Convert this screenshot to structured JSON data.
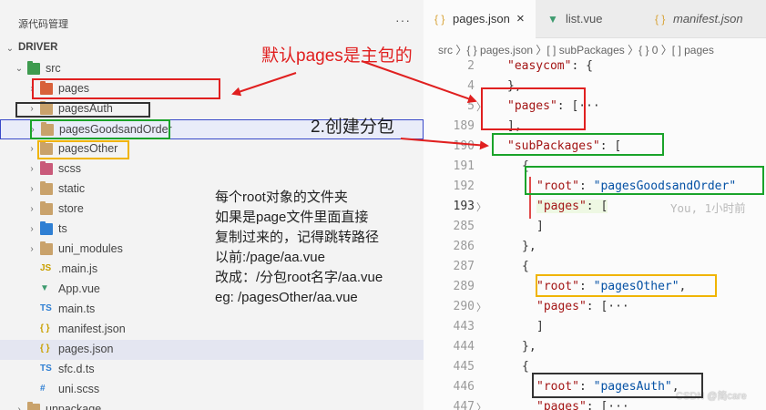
{
  "sidebar": {
    "title": "源代码管理",
    "more": "···",
    "tree": [
      {
        "label": "DRIVER",
        "icon": "none",
        "chevron": "down",
        "depth": 0,
        "bold": true
      },
      {
        "label": "src",
        "icon": "folder-green",
        "chevron": "down",
        "depth": 1
      },
      {
        "label": "pages",
        "icon": "folder-red",
        "chevron": "right",
        "depth": 2
      },
      {
        "label": "pagesAuth",
        "icon": "folder",
        "chevron": "right",
        "depth": 2
      },
      {
        "label": "pagesGoodsandOrder",
        "icon": "folder",
        "chevron": "right",
        "depth": 2
      },
      {
        "label": "pagesOther",
        "icon": "folder",
        "chevron": "right",
        "depth": 2
      },
      {
        "label": "scss",
        "icon": "folder-pink",
        "chevron": "right",
        "depth": 2
      },
      {
        "label": "static",
        "icon": "folder",
        "chevron": "right",
        "depth": 2
      },
      {
        "label": "store",
        "icon": "folder",
        "chevron": "right",
        "depth": 2
      },
      {
        "label": "ts",
        "icon": "folder-blue",
        "chevron": "right",
        "depth": 2
      },
      {
        "label": "uni_modules",
        "icon": "folder",
        "chevron": "right",
        "depth": 2
      },
      {
        "label": ".main.js",
        "icon": "js-file",
        "chevron": "none",
        "depth": 2
      },
      {
        "label": "App.vue",
        "icon": "vue-file",
        "chevron": "none",
        "depth": 2
      },
      {
        "label": "main.ts",
        "icon": "ts-file",
        "chevron": "none",
        "depth": 2
      },
      {
        "label": "manifest.json",
        "icon": "json-file",
        "chevron": "none",
        "depth": 2
      },
      {
        "label": "pages.json",
        "icon": "json-file",
        "chevron": "none",
        "depth": 2,
        "selected": true
      },
      {
        "label": "sfc.d.ts",
        "icon": "ts-file",
        "chevron": "none",
        "depth": 2
      },
      {
        "label": "uni.scss",
        "icon": "css-file",
        "chevron": "none",
        "depth": 2
      },
      {
        "label": "unpackage",
        "icon": "folder",
        "chevron": "right",
        "depth": 1
      }
    ]
  },
  "annotations": {
    "main_package": "默认pages是主包的",
    "create_subpackage": "2.创建分包",
    "notes": [
      "每个root对象的文件夹",
      "如果是page文件里面直接",
      "复制过来的，记得跳转路径",
      "以前:/page/aa.vue",
      "改成：/分包root名字/aa.vue",
      "eg: /pagesOther/aa.vue"
    ]
  },
  "editor": {
    "tabs": [
      {
        "label": "pages.json",
        "icon": "{ }",
        "active": true,
        "close": "×"
      },
      {
        "label": "list.vue",
        "icon": "vue-icon",
        "active": false
      },
      {
        "label": "manifest.json",
        "icon": "{ }",
        "active": false,
        "italic": true
      }
    ],
    "breadcrumb": "src 〉{ } pages.json 〉[ ] subPackages 〉{ } 0 〉[ ] pages",
    "lines": [
      {
        "num": "2",
        "fold": "",
        "code": [
          [
            "k",
            "\"easycom\""
          ],
          [
            "p",
            ": {"
          ]
        ],
        "indent": 1
      },
      {
        "num": "4",
        "fold": "",
        "code": [
          [
            "p",
            "},"
          ]
        ],
        "indent": 1
      },
      {
        "num": "5",
        "fold": "〉",
        "code": [
          [
            "k",
            "\"pages\""
          ],
          [
            "p",
            ": [···"
          ]
        ],
        "indent": 1
      },
      {
        "num": "189",
        "fold": "",
        "code": [
          [
            "p",
            "],"
          ]
        ],
        "indent": 1
      },
      {
        "num": "190",
        "fold": "",
        "code": [
          [
            "k",
            "\"subPackages\""
          ],
          [
            "p",
            ": ["
          ]
        ],
        "indent": 1
      },
      {
        "num": "191",
        "fold": "",
        "code": [
          [
            "p",
            "{"
          ]
        ],
        "indent": 2
      },
      {
        "num": "192",
        "fold": "",
        "code": [
          [
            "k",
            "\"root\""
          ],
          [
            "p",
            ": "
          ],
          [
            "s",
            "\"pagesGoodsandOrder\""
          ]
        ],
        "indent": 3
      },
      {
        "num": "193",
        "fold": "〉",
        "code": [
          [
            "k",
            "\"pages\""
          ],
          [
            "p",
            ": ["
          ]
        ],
        "indent": 3,
        "current": true,
        "highlight": true
      },
      {
        "num": "285",
        "fold": "",
        "code": [
          [
            "p",
            "]"
          ]
        ],
        "indent": 3
      },
      {
        "num": "286",
        "fold": "",
        "code": [
          [
            "p",
            "},"
          ]
        ],
        "indent": 2
      },
      {
        "num": "287",
        "fold": "",
        "code": [
          [
            "p",
            "{"
          ]
        ],
        "indent": 2
      },
      {
        "num": "289",
        "fold": "",
        "code": [
          [
            "k",
            "\"root\""
          ],
          [
            "p",
            ": "
          ],
          [
            "s",
            "\"pagesOther\""
          ],
          [
            "p",
            ","
          ]
        ],
        "indent": 3
      },
      {
        "num": "290",
        "fold": "〉",
        "code": [
          [
            "k",
            "\"pages\""
          ],
          [
            "p",
            ": [···"
          ]
        ],
        "indent": 3
      },
      {
        "num": "443",
        "fold": "",
        "code": [
          [
            "p",
            "]"
          ]
        ],
        "indent": 3
      },
      {
        "num": "444",
        "fold": "",
        "code": [
          [
            "p",
            "},"
          ]
        ],
        "indent": 2
      },
      {
        "num": "445",
        "fold": "",
        "code": [
          [
            "p",
            "{"
          ]
        ],
        "indent": 2
      },
      {
        "num": "446",
        "fold": "",
        "code": [
          [
            "k",
            "\"root\""
          ],
          [
            "p",
            ": "
          ],
          [
            "s",
            "\"pagesAuth\""
          ],
          [
            "p",
            ","
          ]
        ],
        "indent": 3
      },
      {
        "num": "447",
        "fold": "〉",
        "code": [
          [
            "k",
            "\"pages\""
          ],
          [
            "p",
            ": [···"
          ]
        ],
        "indent": 3
      }
    ],
    "blame": "You, 1小时前"
  },
  "watermark": "CSDN @简care",
  "colors": {
    "red": "#e02020",
    "green": "#1aa32a",
    "yellow": "#f0b400",
    "dark": "#333333",
    "blue": "#3949c9"
  }
}
